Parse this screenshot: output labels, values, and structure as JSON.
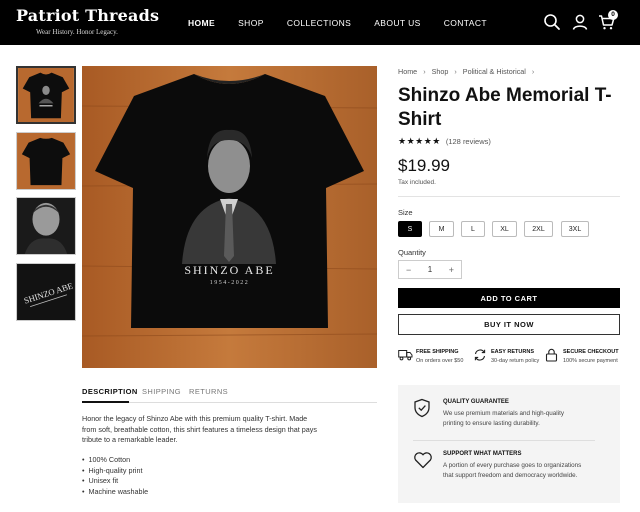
{
  "brand": {
    "name": "Patriot Threads",
    "tagline": "Wear History. Honor Legacy."
  },
  "nav": [
    {
      "label": "HOME",
      "active": true
    },
    {
      "label": "SHOP"
    },
    {
      "label": "COLLECTIONS"
    },
    {
      "label": "ABOUT US"
    },
    {
      "label": "CONTACT"
    }
  ],
  "header_icons": {
    "search": "search-icon",
    "account": "user-icon",
    "cart": "cart-icon",
    "cart_count": "0"
  },
  "breadcrumb": [
    "Home",
    "Shop",
    "Political & Historical"
  ],
  "product": {
    "title": "Shinzo Abe Memorial T-Shirt",
    "rating_stars": "★★★★★",
    "reviews": "(128 reviews)",
    "price": "$19.99",
    "tax_note": "Tax included.",
    "shirt_print_name": "SHINZO ABE",
    "shirt_print_years": "1954-2022"
  },
  "size": {
    "label": "Size",
    "options": [
      "S",
      "M",
      "L",
      "XL",
      "2XL",
      "3XL"
    ],
    "selected": "S"
  },
  "quantity": {
    "label": "Quantity",
    "value": "1",
    "minus": "−",
    "plus": "+"
  },
  "buttons": {
    "add_to_cart": "ADD TO CART",
    "buy_now": "BUY IT NOW"
  },
  "perks": [
    {
      "icon": "truck-icon",
      "title": "FREE SHIPPING",
      "subtitle": "On orders over $50"
    },
    {
      "icon": "return-icon",
      "title": "EASY RETURNS",
      "subtitle": "30-day return policy"
    },
    {
      "icon": "lock-icon",
      "title": "SECURE CHECKOUT",
      "subtitle": "100% secure payment"
    }
  ],
  "tabs": [
    {
      "label": "DESCRIPTION",
      "active": true
    },
    {
      "label": "SHIPPING"
    },
    {
      "label": "RETURNS"
    }
  ],
  "description": "Honor the legacy of Shinzo Abe with this premium quality T-shirt. Made from soft, breathable cotton, this shirt features a timeless design that pays tribute to a remarkable leader.",
  "features": [
    "100% Cotton",
    "High-quality print",
    "Unisex fit",
    "Machine washable"
  ],
  "info": [
    {
      "icon": "shield-icon",
      "title": "QUALITY GUARANTEE",
      "text": "We use premium materials and high-quality printing to ensure lasting durability."
    },
    {
      "icon": "heart-icon",
      "title": "SUPPORT WHAT MATTERS",
      "text": "A portion of every purchase goes to organizations that support freedom and democracy worldwide."
    }
  ],
  "colors": {
    "header_bg": "#000000",
    "accent": "#000000",
    "wood": "#b8692f"
  }
}
